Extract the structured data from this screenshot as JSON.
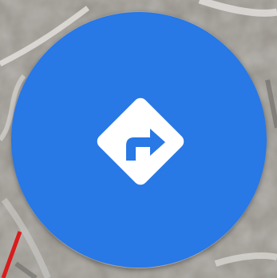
{
  "map": {
    "icon": "satellite-map-background"
  },
  "directions_button": {
    "icon": "directions-turn-right-icon",
    "background_color": "#2878e6",
    "icon_color": "#ffffff"
  }
}
